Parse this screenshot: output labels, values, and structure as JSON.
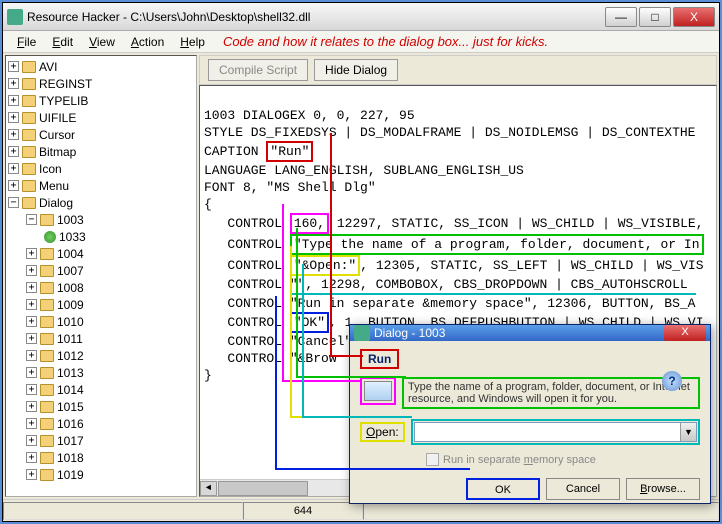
{
  "window": {
    "title": "Resource Hacker  -  C:\\Users\\John\\Desktop\\shell32.dll",
    "min": "—",
    "max": "□",
    "close": "X"
  },
  "menu": {
    "file": "File",
    "edit": "Edit",
    "view": "View",
    "action": "Action",
    "help": "Help",
    "annotation": "Code and how it relates to the dialog box... just for kicks."
  },
  "toolbar": {
    "compile": "Compile Script",
    "hide": "Hide Dialog"
  },
  "tree": {
    "top": [
      {
        "label": "AVI",
        "exp": "+"
      },
      {
        "label": "REGINST",
        "exp": "+"
      },
      {
        "label": "TYPELIB",
        "exp": "+"
      },
      {
        "label": "UIFILE",
        "exp": "+"
      },
      {
        "label": "Cursor",
        "exp": "+"
      },
      {
        "label": "Bitmap",
        "exp": "+"
      },
      {
        "label": "Icon",
        "exp": "+"
      },
      {
        "label": "Menu",
        "exp": "+"
      }
    ],
    "dialog": {
      "label": "Dialog",
      "exp": "−"
    },
    "node1003": {
      "label": "1003",
      "exp": "−"
    },
    "leaf1033": "1033",
    "rest": [
      "1004",
      "1007",
      "1008",
      "1009",
      "1010",
      "1011",
      "1012",
      "1013",
      "1014",
      "1015",
      "1016",
      "1017",
      "1018",
      "1019"
    ]
  },
  "code": {
    "l1": "1003 DIALOGEX 0, 0, 227, 95",
    "l2": "STYLE DS_FIXEDSYS | DS_MODALFRAME | DS_NOIDLEMSG | DS_CONTEXTHE",
    "l3_a": "CAPTION ",
    "l3_b": "\"Run\"",
    "l4": "LANGUAGE LANG_ENGLISH, SUBLANG_ENGLISH_US",
    "l5": "FONT 8, \"MS Shell Dlg\"",
    "l6": "{",
    "l7_a": "   CONTROL ",
    "l7_b": "160,",
    "l7_c": " 12297, STATIC, SS_ICON | WS_CHILD | WS_VISIBLE,",
    "l8_a": "   CONTROL ",
    "l8_b": "\"Type the name of a program, folder, document, or In",
    "l9_a": "   CONTROL ",
    "l9_b": "\"&Open:\"",
    "l9_c": ", 12305, STATIC, SS_LEFT | WS_CHILD | WS_VIS",
    "l10_a": "   CONTROL ",
    "l10_b": "\"\", 12298, COMBOBOX, CBS_DROPDOWN | CBS_AUTOHSCROLL ",
    "l11": "   CONTROL \"Run in separate &memory space\", 12306, BUTTON, BS_A",
    "l12_a": "   CONTROL ",
    "l12_b": "\"OK\"",
    "l12_c": ", 1, BUTTON, BS_DEFPUSHBUTTON | WS_CHILD | WS_VI",
    "l13": "   CONTROL \"Cancel\"  2  BUTTON  BS_PUSHBUTTON | WS_CHILD | WS_V",
    "l14": "   CONTROL \"&Brow",
    "l15": "}"
  },
  "dialog": {
    "title": "Dialog - 1003",
    "run_caption": "Run",
    "desc": "Type the name of a program, folder, document, or Internet resource, and Windows will open it for you.",
    "open_label": "Open:",
    "memory": "Run in separate memory space",
    "ok": "OK",
    "cancel": "Cancel",
    "browse": "Browse...",
    "help": "?",
    "close": "X"
  },
  "status": {
    "cell2": "644"
  }
}
